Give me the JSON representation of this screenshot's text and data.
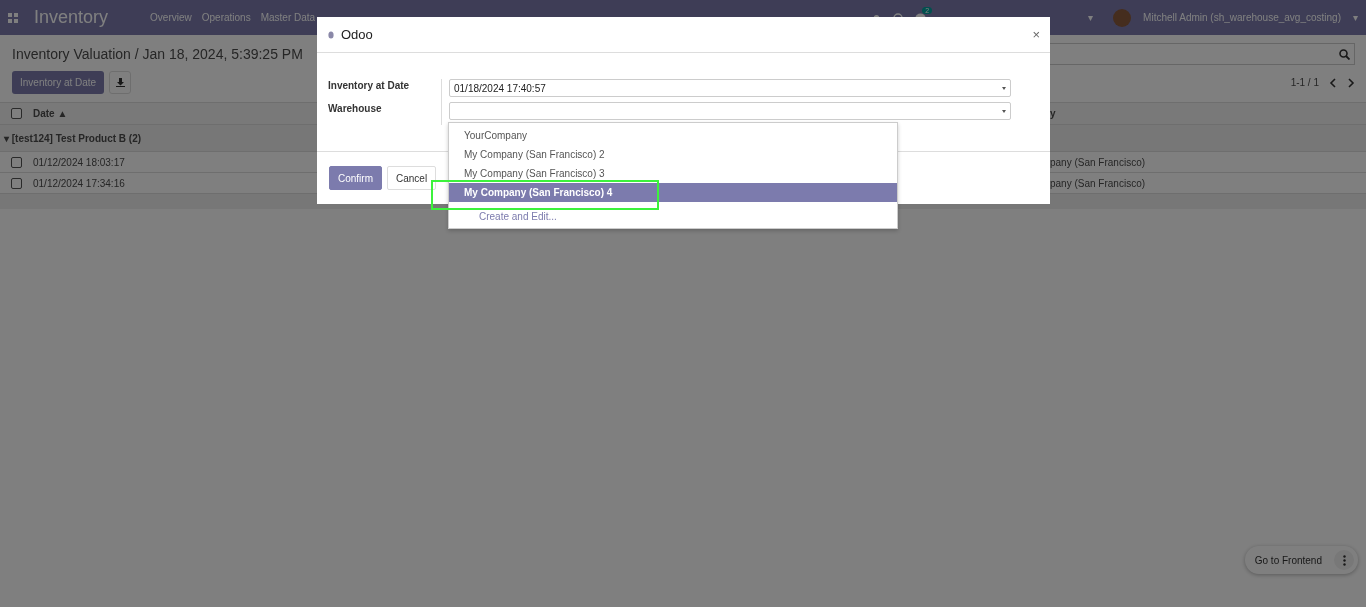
{
  "navbar": {
    "app_name": "Inventory",
    "menu": [
      "Overview",
      "Operations",
      "Master Data"
    ],
    "messages_count": "2",
    "company_caret": "▾",
    "user": "Mitchell Admin (sh_warehouse_avg_costing)",
    "user_caret": "▾"
  },
  "control_panel": {
    "breadcrumb": "Inventory Valuation / Jan 18, 2024, 5:39:25 PM",
    "primary_button": "Inventory at Date",
    "pager": "1-1 / 1"
  },
  "table": {
    "select_all_checked": false,
    "columns": [
      {
        "label": "Date",
        "sort_indicator": "▲"
      },
      {
        "label": "y"
      }
    ],
    "group": {
      "expand_icon": "▾",
      "label": "[test124] Test Product B (2)"
    },
    "rows": [
      {
        "date": "01/12/2024 18:03:17",
        "company": "pany (San Francisco)",
        "checked": false
      },
      {
        "date": "01/12/2024 17:34:16",
        "company": "pany (San Francisco)",
        "checked": false
      }
    ]
  },
  "dialog": {
    "title": "Odoo",
    "close": "×",
    "fields": [
      {
        "label": "Inventory at Date",
        "value": "01/18/2024 17:40:57"
      },
      {
        "label": "Warehouse"
      }
    ],
    "dropdown": {
      "options": [
        {
          "label": "YourCompany",
          "selected": false
        },
        {
          "label": "My Company (San Francisco) 2",
          "selected": false
        },
        {
          "label": "My Company (San Francisco) 3",
          "selected": false
        },
        {
          "label": "My Company (San Francisco) 4",
          "selected": true
        }
      ],
      "create_link": "Create and Edit..."
    },
    "buttons": [
      "Confirm",
      "Cancel"
    ]
  },
  "frontend_button": "Go to Frontend"
}
